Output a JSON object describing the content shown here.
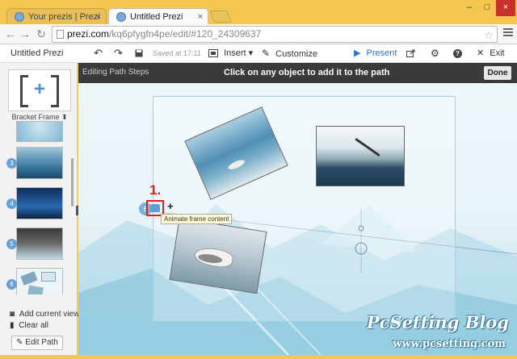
{
  "browser": {
    "tabs": [
      {
        "title": "Your prezis | Prezi",
        "close": "×"
      },
      {
        "title": "Untitled Prezi",
        "close": "×"
      }
    ],
    "window_controls": [
      "–",
      "□",
      "×"
    ],
    "url_host": "prezi.com",
    "url_path": "/kq6pfygfn4pe/edit/#120_24309637",
    "star": "☆"
  },
  "toolbar": {
    "title": "Untitled Prezi",
    "saved": "Saved at 17:11",
    "insert": "Insert",
    "customize": "Customize",
    "present": "Present",
    "exit": "Exit"
  },
  "sidebar": {
    "frame_label": "Bracket Frame",
    "thumbnails": [
      "3",
      "4",
      "5",
      "6"
    ],
    "add_current_view": "Add current view",
    "clear_all": "Clear all",
    "edit_path": "Edit Path"
  },
  "canvas": {
    "bar_left": "Editing Path Steps",
    "bar_center": "Click on any object to add it to the path",
    "done": "Done",
    "callout_number": "1.",
    "tooltip": "Animate frame content",
    "step_number": "6",
    "plus": "+"
  },
  "watermark": {
    "line1": "PcSetting Blog",
    "line2": "www.pcsetting.com"
  }
}
